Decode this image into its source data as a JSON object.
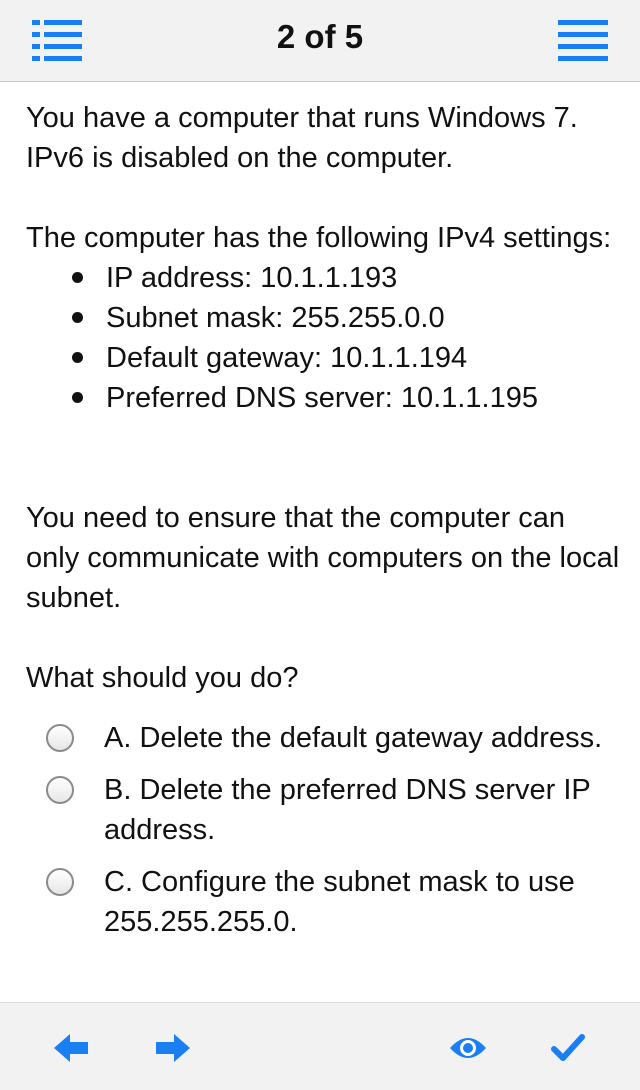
{
  "header": {
    "title": "2 of 5",
    "left_icon": "list-icon",
    "right_icon": "menu-icon"
  },
  "question": {
    "intro": "You have a computer that runs Windows 7. IPv6 is disabled on the computer.",
    "settings_intro": "The computer has the following IPv4 settings:",
    "settings": [
      "IP address: 10.1.1.193",
      "Subnet mask: 255.255.0.0",
      "Default gateway: 10.1.1.194",
      "Preferred DNS server: 10.1.1.195"
    ],
    "requirement": "You need to ensure that the computer can only communicate with computers on the local subnet.",
    "prompt": "What should you do?",
    "options": [
      "A. Delete the default gateway address.",
      "B. Delete the preferred DNS server IP address.",
      "C. Configure the subnet mask to use 255.255.255.0."
    ]
  },
  "footer": {
    "icons": [
      "arrow-left-icon",
      "arrow-right-icon",
      "eye-icon",
      "checkmark-icon"
    ]
  },
  "colors": {
    "accent": "#1a7ef5",
    "bar_background": "#f2f2f2",
    "text": "#111111"
  }
}
